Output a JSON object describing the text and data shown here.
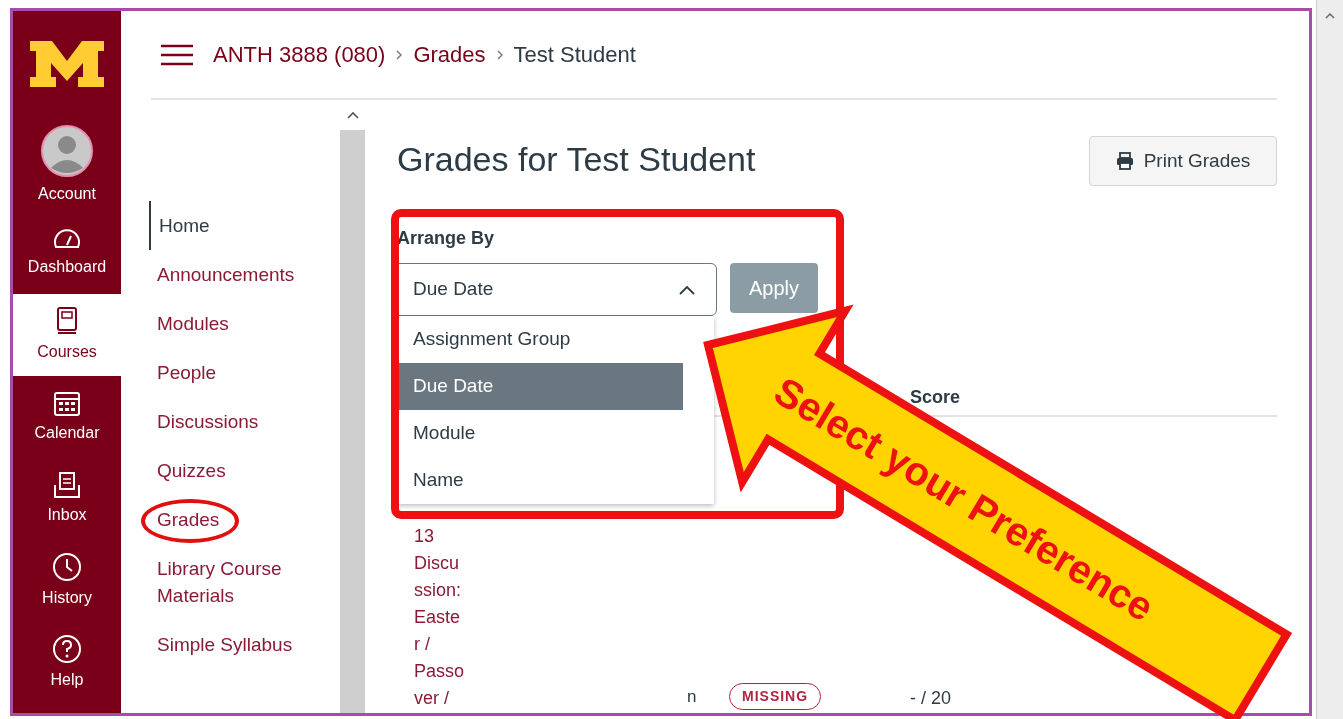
{
  "global_nav": [
    {
      "label": "Account",
      "selected": false
    },
    {
      "label": "Dashboard",
      "selected": false
    },
    {
      "label": "Courses",
      "selected": true
    },
    {
      "label": "Calendar",
      "selected": false
    },
    {
      "label": "Inbox",
      "selected": false
    },
    {
      "label": "History",
      "selected": false
    },
    {
      "label": "Help",
      "selected": false
    }
  ],
  "breadcrumb": [
    {
      "label": "ANTH 3888 (080)",
      "kind": "link"
    },
    {
      "label": "Grades",
      "kind": "link"
    },
    {
      "label": "Test Student",
      "kind": "current"
    }
  ],
  "course_nav": [
    {
      "label": "Home",
      "selected": true,
      "circled": false
    },
    {
      "label": "Announcements",
      "selected": false,
      "circled": false
    },
    {
      "label": "Modules",
      "selected": false,
      "circled": false
    },
    {
      "label": "People",
      "selected": false,
      "circled": false
    },
    {
      "label": "Discussions",
      "selected": false,
      "circled": false
    },
    {
      "label": "Quizzes",
      "selected": false,
      "circled": false
    },
    {
      "label": "Grades",
      "selected": false,
      "circled": true
    },
    {
      "label": "Library Course Materials",
      "selected": false,
      "circled": false
    },
    {
      "label": "Simple Syllabus",
      "selected": false,
      "circled": false
    }
  ],
  "page_title": "Grades for Test Student",
  "print_button": "Print Grades",
  "arrange_by": {
    "label": "Arrange By",
    "value": "Due Date",
    "expanded": true,
    "apply_button": "Apply",
    "options": [
      {
        "label": "Assignment Group",
        "selected": false
      },
      {
        "label": "Due Date",
        "selected": true
      },
      {
        "label": "Module",
        "selected": false
      },
      {
        "label": "Name",
        "selected": false
      }
    ]
  },
  "table": {
    "score_header": "Score",
    "rows": [
      {
        "assignment_lines": [
          "13",
          "Discu",
          "ssion:",
          "Easte",
          "r /",
          "Passo",
          "ver /"
        ],
        "status_text": "n",
        "badge": "MISSING",
        "score": "- / 20"
      }
    ]
  },
  "annotation_arrow": {
    "text": "Select your Preference"
  }
}
